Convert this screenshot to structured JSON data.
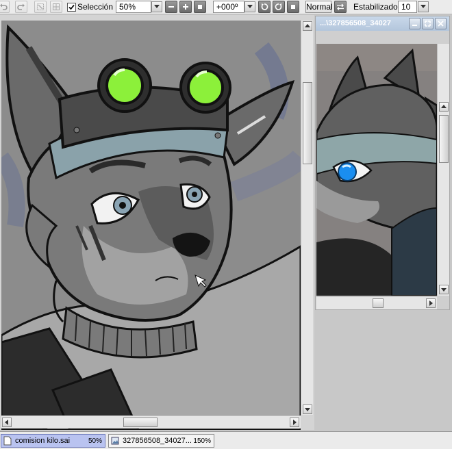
{
  "toolbar": {
    "selection_label": "Selección",
    "selection_checked": true,
    "zoom_value": "50%",
    "rotation_value": "+000º",
    "blend_mode": "Normal",
    "stabilizer_label": "Estabilizador",
    "stabilizer_value": "10"
  },
  "sub_window": {
    "title": "...\\327856508_34027"
  },
  "documents": [
    {
      "name": "comision kilo.sai",
      "zoom": "50%",
      "active": true
    },
    {
      "name": "327856508_34027...",
      "zoom": "150%",
      "active": false
    }
  ],
  "colors": {
    "accent_goggle": "#8cf03a",
    "doc_tab_active": "#b9c3f0",
    "eye_blue": "#1a8ef0"
  }
}
